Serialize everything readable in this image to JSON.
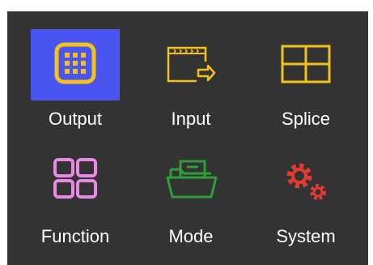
{
  "colors": {
    "screen_bg": "#333333",
    "selected_bg": "#4a55f0",
    "yellow": "#f2c21b",
    "pink": "#e98ae6",
    "green": "#2f9e3a",
    "red": "#e23b33"
  },
  "menu": {
    "items": [
      {
        "label": "Output",
        "icon": "output-grid-icon",
        "selected": true
      },
      {
        "label": "Input",
        "icon": "input-arrow-icon",
        "selected": false
      },
      {
        "label": "Splice",
        "icon": "splice-grid-icon",
        "selected": false
      },
      {
        "label": "Function",
        "icon": "function-squares-icon",
        "selected": false
      },
      {
        "label": "Mode",
        "icon": "mode-folder-icon",
        "selected": false
      },
      {
        "label": "System",
        "icon": "system-gears-icon",
        "selected": false
      }
    ]
  }
}
